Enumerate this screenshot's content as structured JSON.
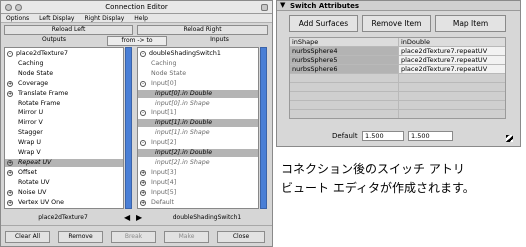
{
  "connection_editor": {
    "title": "Connection Editor",
    "menu": [
      "Options",
      "Left Display",
      "Right Display",
      "Help"
    ],
    "reload_left": "Reload Left",
    "reload_right": "Reload Right",
    "outputs_label": "Outputs",
    "direction_label": "from -> to",
    "inputs_label": "Inputs",
    "left_rows": [
      {
        "text": "place2dTexture7",
        "icon": "-",
        "indent": 0,
        "hl": false,
        "style": ""
      },
      {
        "text": "Caching",
        "icon": "",
        "indent": 1,
        "hl": false,
        "style": ""
      },
      {
        "text": "Node State",
        "icon": "",
        "indent": 1,
        "hl": false,
        "style": ""
      },
      {
        "text": "Coverage",
        "icon": "+",
        "indent": 1,
        "hl": false,
        "style": ""
      },
      {
        "text": "Translate Frame",
        "icon": "+",
        "indent": 1,
        "hl": false,
        "style": ""
      },
      {
        "text": "Rotate Frame",
        "icon": "",
        "indent": 1,
        "hl": false,
        "style": ""
      },
      {
        "text": "Mirror U",
        "icon": "",
        "indent": 1,
        "hl": false,
        "style": ""
      },
      {
        "text": "Mirror V",
        "icon": "",
        "indent": 1,
        "hl": false,
        "style": ""
      },
      {
        "text": "Stagger",
        "icon": "",
        "indent": 1,
        "hl": false,
        "style": ""
      },
      {
        "text": "Wrap U",
        "icon": "",
        "indent": 1,
        "hl": false,
        "style": ""
      },
      {
        "text": "Wrap V",
        "icon": "",
        "indent": 1,
        "hl": false,
        "style": ""
      },
      {
        "text": "Repeat UV",
        "icon": "+",
        "indent": 1,
        "hl": true,
        "style": "it"
      },
      {
        "text": "Offset",
        "icon": "+",
        "indent": 1,
        "hl": false,
        "style": ""
      },
      {
        "text": "Rotate UV",
        "icon": "",
        "indent": 1,
        "hl": false,
        "style": ""
      },
      {
        "text": "Noise UV",
        "icon": "+",
        "indent": 1,
        "hl": false,
        "style": ""
      },
      {
        "text": "Vertex UV One",
        "icon": "+",
        "indent": 1,
        "hl": false,
        "style": ""
      }
    ],
    "right_rows": [
      {
        "text": "doubleShadingSwitch1",
        "icon": "-",
        "indent": 0,
        "hl": false,
        "style": ""
      },
      {
        "text": "Caching",
        "icon": "",
        "indent": 1,
        "hl": false,
        "style": "gr"
      },
      {
        "text": "Node State",
        "icon": "",
        "indent": 1,
        "hl": false,
        "style": "gr"
      },
      {
        "text": "Input[0]",
        "icon": "-",
        "indent": 1,
        "hl": false,
        "style": "gr"
      },
      {
        "text": "input[0].in Double",
        "icon": "",
        "indent": 2,
        "hl": true,
        "style": "it"
      },
      {
        "text": "input[0].in Shape",
        "icon": "",
        "indent": 2,
        "hl": false,
        "style": "it gr"
      },
      {
        "text": "Input[1]",
        "icon": "-",
        "indent": 1,
        "hl": false,
        "style": "gr"
      },
      {
        "text": "input[1].in Double",
        "icon": "",
        "indent": 2,
        "hl": true,
        "style": "it"
      },
      {
        "text": "input[1].in Shape",
        "icon": "",
        "indent": 2,
        "hl": false,
        "style": "it gr"
      },
      {
        "text": "Input[2]",
        "icon": "-",
        "indent": 1,
        "hl": false,
        "style": "gr"
      },
      {
        "text": "input[2].in Double",
        "icon": "",
        "indent": 2,
        "hl": true,
        "style": "it"
      },
      {
        "text": "input[2].in Shape",
        "icon": "",
        "indent": 2,
        "hl": false,
        "style": "it gr"
      },
      {
        "text": "Input[3]",
        "icon": "+",
        "indent": 1,
        "hl": false,
        "style": "gr"
      },
      {
        "text": "Input[4]",
        "icon": "+",
        "indent": 1,
        "hl": false,
        "style": "gr"
      },
      {
        "text": "Input[5]",
        "icon": "+",
        "indent": 1,
        "hl": false,
        "style": "gr"
      },
      {
        "text": "Default",
        "icon": "+",
        "indent": 1,
        "hl": false,
        "style": "gr"
      }
    ],
    "left_node": "place2dTexture7",
    "right_node": "doubleShadingSwitch1",
    "buttons": [
      "Clear All",
      "Remove",
      "Break",
      "Make",
      "Close"
    ]
  },
  "switch_attributes": {
    "title": "Switch Attributes",
    "add_surfaces": "Add Surfaces",
    "remove_item": "Remove Item",
    "map_item": "Map Item",
    "col_in_shape": "inShape",
    "col_in_double": "inDouble",
    "rows": [
      {
        "shape": "nurbsSphere4",
        "double": "place2dTexture7.repeatUV"
      },
      {
        "shape": "nurbsSphere5",
        "double": "place2dTexture7.repeatUV"
      },
      {
        "shape": "nurbsSphere6",
        "double": "place2dTexture7.repeatUV"
      }
    ],
    "default_label": "Default",
    "default_value_1": "1.500",
    "default_value_2": "1.500"
  },
  "caption": {
    "line1": "コネクション後のスイッチ アトリ",
    "line2": "ビュート エディタが作成されます。"
  }
}
